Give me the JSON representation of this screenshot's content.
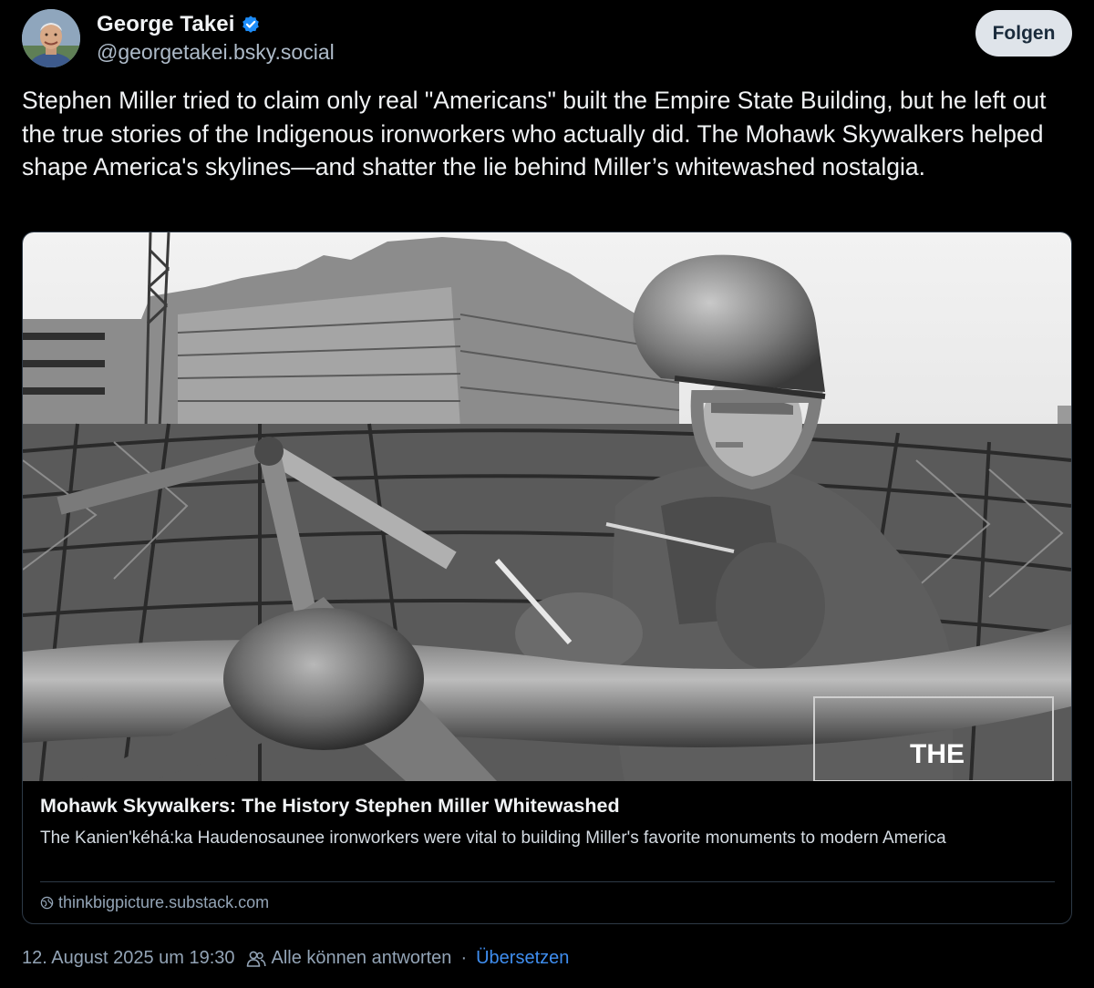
{
  "author": {
    "display_name": "George Takei",
    "handle": "@georgetakei.bsky.social",
    "verified": true
  },
  "follow_button": {
    "label": "Folgen"
  },
  "post": {
    "text": "Stephen Miller tried to claim only real \"Americans\" built the Empire State Building, but he left out the true stories of the Indigenous ironworkers who actually did. The Mohawk Skywalkers helped shape America's skylines—and shatter the lie behind Miller’s whitewashed nostalgia."
  },
  "link_card": {
    "title": "Mohawk Skywalkers: The History Stephen Miller Whitewashed",
    "description": "The Kanien'kéhá:ka Haudenosaunee ironworkers were vital to building Miller's favorite monuments to modern America",
    "domain": "thinkbigpicture.substack.com",
    "image_watermark": "THE"
  },
  "meta": {
    "timestamp": "12. August 2025 um 19:30",
    "reply_setting": "Alle können antworten",
    "separator": "·",
    "translate_label": "Übersetzen"
  },
  "colors": {
    "background": "#000000",
    "primary_text": "#f1f3f5",
    "secondary_text": "#93a4b6",
    "link": "#3f8ef0",
    "verified_badge": "#1d8cf8",
    "border": "#2e3a47",
    "follow_button_bg": "#dfe4ea"
  }
}
